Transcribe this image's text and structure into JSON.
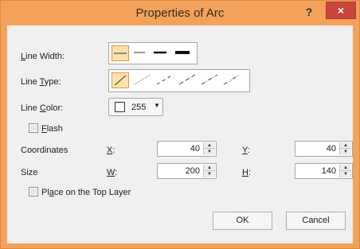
{
  "window": {
    "title": "Properties of Arc",
    "help_label": "?",
    "close_label": "×"
  },
  "line_width": {
    "label_accel": "L",
    "label_rest": "ine Width:"
  },
  "line_type": {
    "label_pre": "Line ",
    "label_accel": "T",
    "label_rest": "ype:"
  },
  "line_color": {
    "label_pre": "Line ",
    "label_accel": "C",
    "label_rest": "olor:",
    "value": "255"
  },
  "flash": {
    "label_accel": "F",
    "label_rest": "lash"
  },
  "coordinates": {
    "label": "Coordinates",
    "x_accel": "X",
    "x_rest": ":",
    "x_value": "40",
    "y_accel": "Y",
    "y_rest": ":",
    "y_value": "40"
  },
  "size": {
    "label": "Size",
    "w_accel": "W",
    "w_rest": ":",
    "w_value": "200",
    "h_accel": "H",
    "h_rest": ":",
    "h_value": "140"
  },
  "top_layer": {
    "label_pre": "Pl",
    "label_accel": "a",
    "label_rest": "ce on the Top Layer"
  },
  "buttons": {
    "ok": "OK",
    "cancel": "Cancel"
  },
  "colors": {
    "title_bar": "#f2a25a",
    "close_button": "#c9453d",
    "selection_fill": "#fde0b0",
    "selection_border": "#e29a3f"
  }
}
